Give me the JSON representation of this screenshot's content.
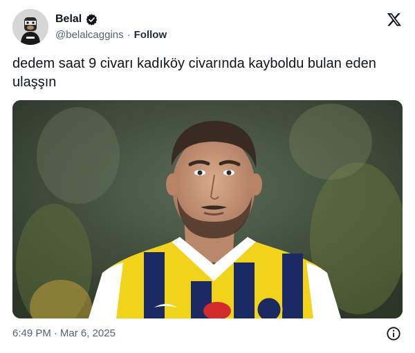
{
  "author": {
    "display_name": "Belal",
    "handle": "@belalcaggins",
    "follow_label": "Follow",
    "verified": true
  },
  "tweet": {
    "text": "dedem saat 9 civarı kadıköy civarında kayboldu bulan eden ulaşşın"
  },
  "footer": {
    "time": "6:49 PM",
    "date": "Mar 6, 2025",
    "separator": "·"
  },
  "icons": {
    "verified": "verified-badge-icon",
    "brand": "x-logo-icon",
    "info": "info-icon"
  },
  "colors": {
    "text_primary": "#0f1419",
    "text_secondary": "#536471",
    "jersey_navy": "#1c2a63",
    "jersey_yellow": "#f2d31b"
  }
}
